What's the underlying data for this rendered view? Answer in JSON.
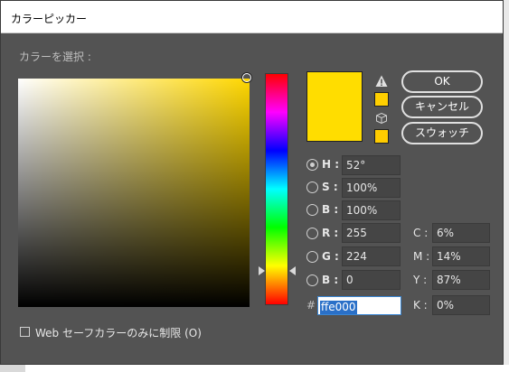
{
  "dialog": {
    "title": "カラーピッカー",
    "select_label": "カラーを選択 :"
  },
  "colors": {
    "new_color": "#ffdd00",
    "gamut_correction": "#ffcf00",
    "websafe_correction": "#ffcc00"
  },
  "buttons": {
    "ok": "OK",
    "cancel": "キャンセル",
    "swatches": "スウォッチ"
  },
  "hsb": [
    {
      "label": "H :",
      "value": "52°",
      "selected": true
    },
    {
      "label": "S :",
      "value": "100%",
      "selected": false
    },
    {
      "label": "B :",
      "value": "100%",
      "selected": false
    }
  ],
  "rgb": [
    {
      "label": "R :",
      "value": "255",
      "selected": false
    },
    {
      "label": "G :",
      "value": "224",
      "selected": false
    },
    {
      "label": "B :",
      "value": "0",
      "selected": false
    }
  ],
  "cmyk": [
    {
      "label": "C :",
      "value": "6%"
    },
    {
      "label": "M :",
      "value": "14%"
    },
    {
      "label": "Y :",
      "value": "87%"
    },
    {
      "label": "K :",
      "value": "0%"
    }
  ],
  "hex": {
    "label": "#",
    "value": "ffe000"
  },
  "websafe_only": {
    "label": "Web セーフカラーのみに制限 (O)",
    "checked": false
  },
  "icons": {
    "gamut_warning": "warning-triangle-icon",
    "websafe_warning": "cube-icon"
  }
}
